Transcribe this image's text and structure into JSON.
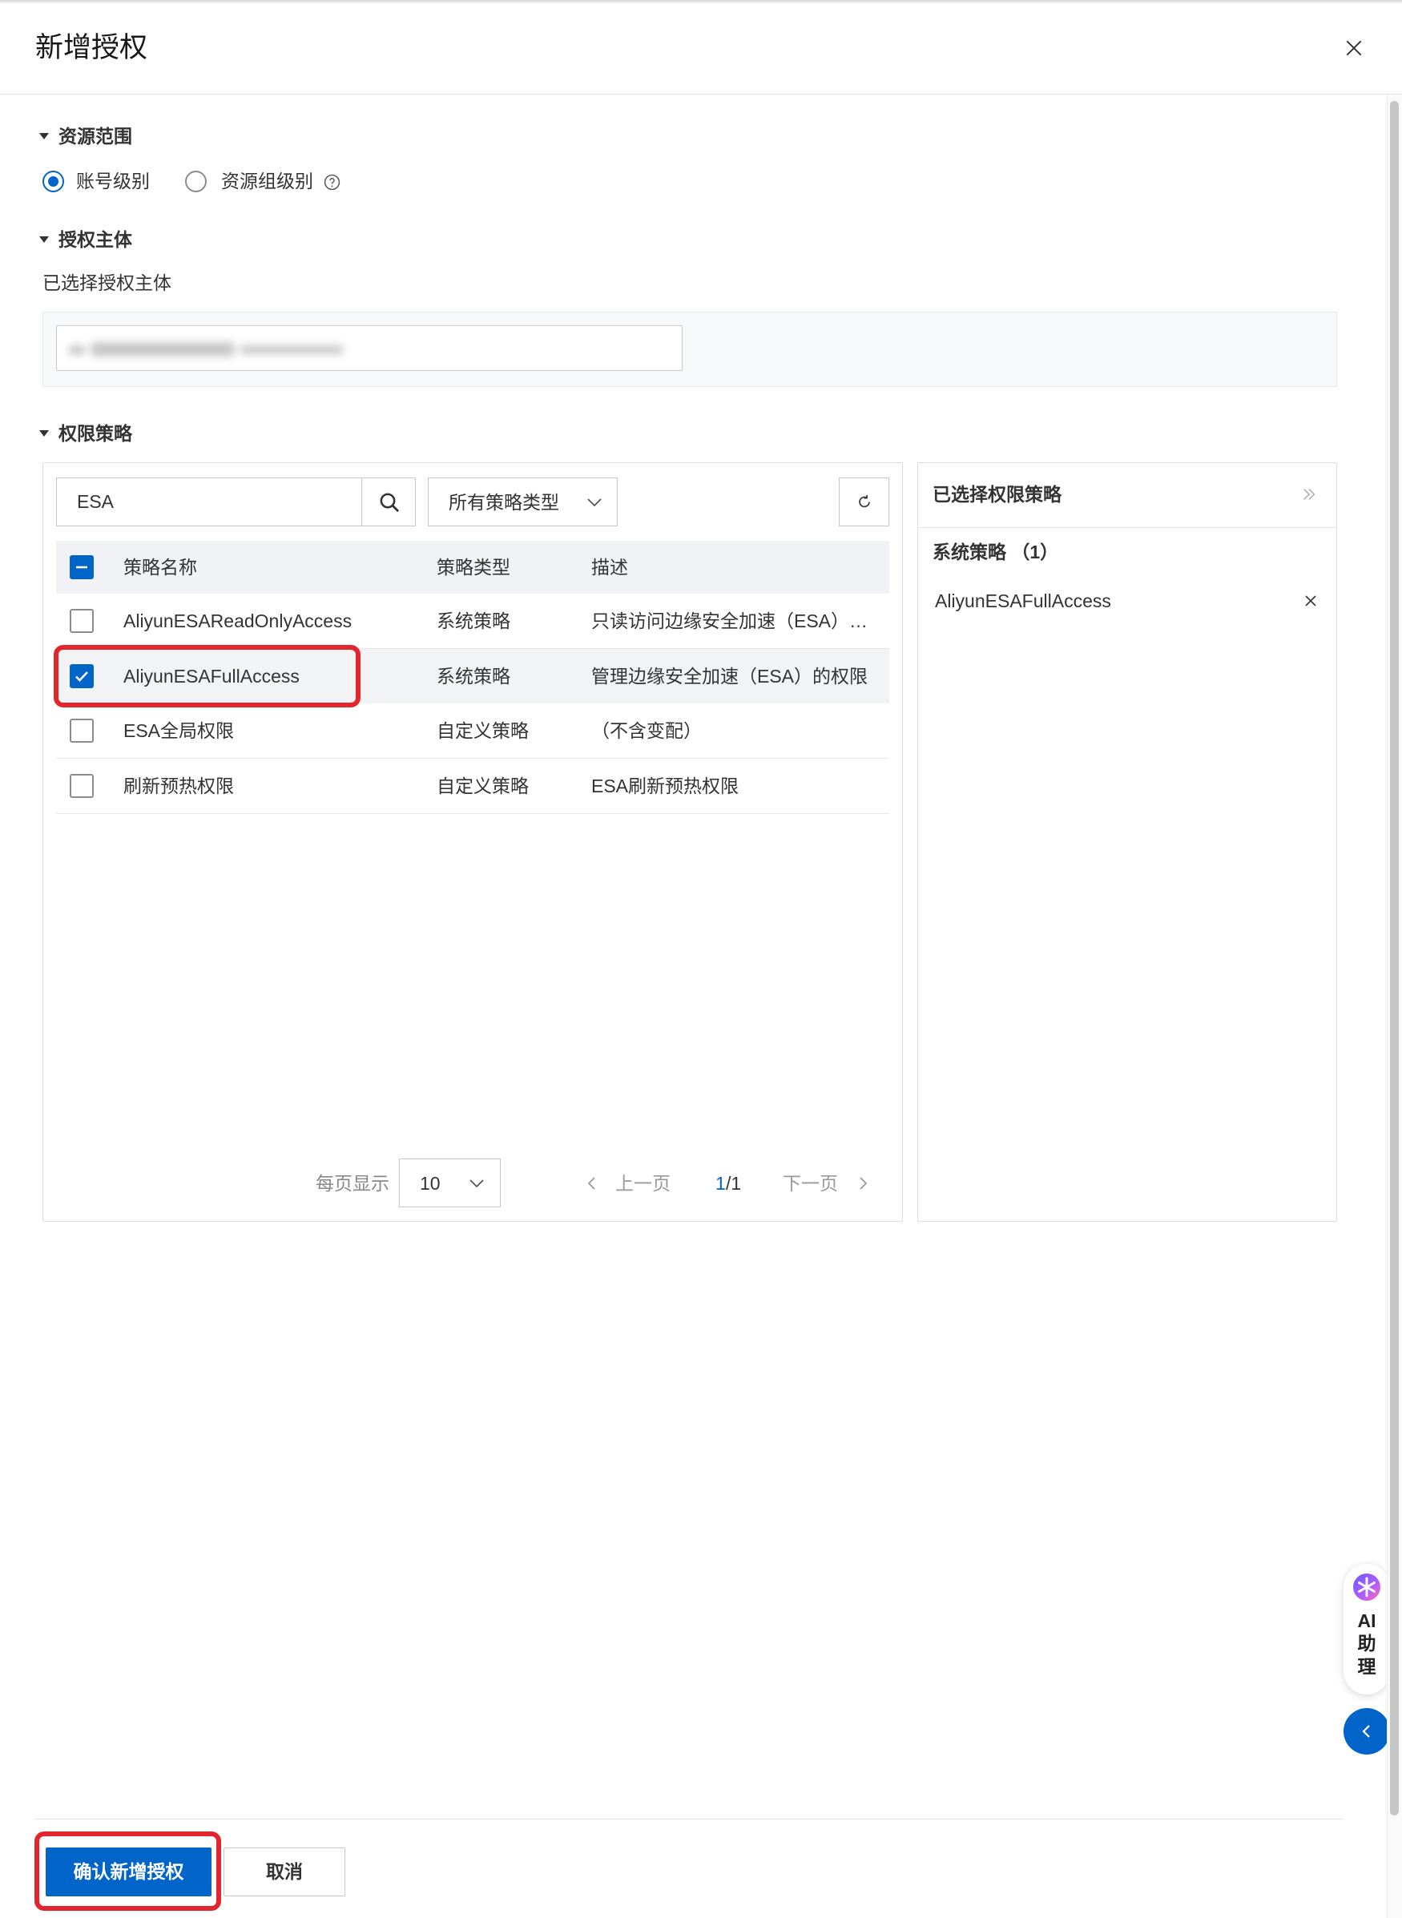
{
  "dialog": {
    "title": "新增授权"
  },
  "resource_scope": {
    "heading": "资源范围",
    "options": [
      {
        "label": "账号级别",
        "selected": true
      },
      {
        "label": "资源组级别",
        "selected": false
      }
    ]
  },
  "principal": {
    "heading": "授权主体",
    "selected_label": "已选择授权主体"
  },
  "policies": {
    "heading": "权限策略",
    "search_value": "ESA",
    "type_filter": "所有策略类型",
    "select_all_partial": true,
    "columns": {
      "name": "策略名称",
      "type": "策略类型",
      "description": "描述"
    },
    "rows": [
      {
        "name": "AliyunESAReadOnlyAccess",
        "type": "系统策略",
        "description": "只读访问边缘安全加速（ESA）…",
        "checked": false
      },
      {
        "name": "AliyunESAFullAccess",
        "type": "系统策略",
        "description": "管理边缘安全加速（ESA）的权限",
        "checked": true
      },
      {
        "name": "ESA全局权限",
        "type": "自定义策略",
        "description": "（不含变配）",
        "checked": false
      },
      {
        "name": "刷新预热权限",
        "type": "自定义策略",
        "description": "ESA刷新预热权限",
        "checked": false
      }
    ],
    "pagination": {
      "page_size_label": "每页显示",
      "page_size": "10",
      "prev_label": "上一页",
      "current_page": "1",
      "total_pages_text": "/1",
      "next_label": "下一页"
    }
  },
  "selected_policies": {
    "title": "已选择权限策略",
    "group_label": "系统策略 （1）",
    "items": [
      {
        "name": "AliyunESAFullAccess"
      }
    ]
  },
  "assistant": {
    "line1": "AI",
    "line2": "助",
    "line3": "理"
  },
  "footer": {
    "confirm_label": "确认新增授权",
    "cancel_label": "取消"
  },
  "colors": {
    "primary": "#0064c8",
    "highlight": "#e3262d",
    "text": "#333333",
    "muted": "#888888",
    "table_header_bg": "#f0f2f5"
  },
  "icons": [
    "close-icon",
    "caret-down-icon",
    "help-circle-icon",
    "search-icon",
    "chevron-down-icon",
    "refresh-icon",
    "check-icon",
    "chevron-left-icon",
    "chevron-right-icon",
    "double-chevron-right-icon",
    "ai-assistant-icon"
  ]
}
